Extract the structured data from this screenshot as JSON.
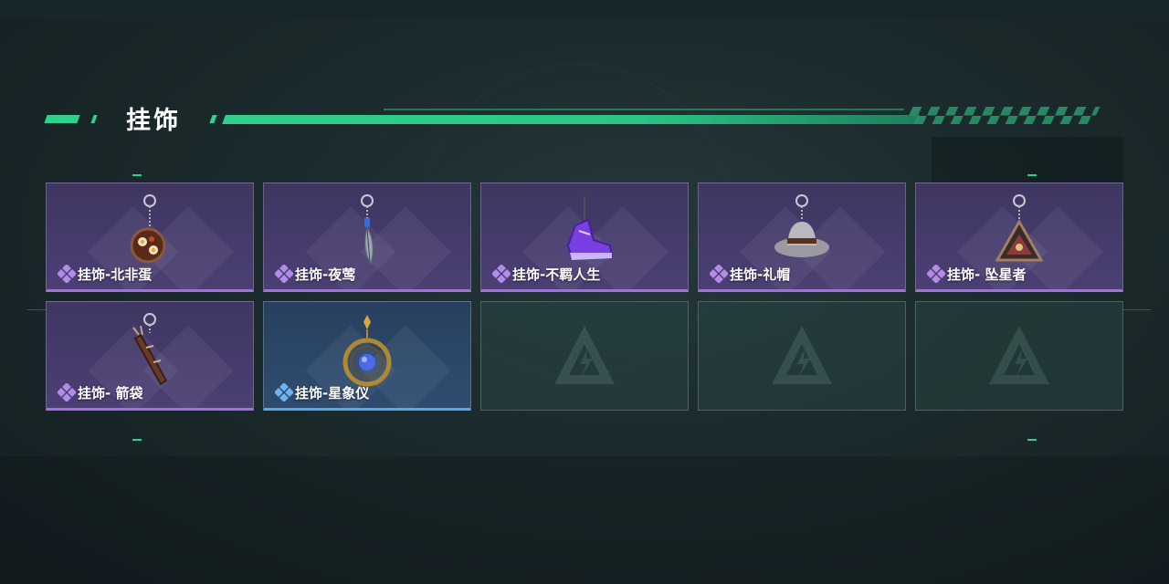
{
  "section": {
    "title": "挂饰"
  },
  "colors": {
    "accent": "#2fd08a",
    "purple_rarity": "#a46ee0",
    "blue_rarity": "#5aa6e6"
  },
  "items": [
    {
      "label": "挂饰-北非蛋",
      "rarity": "purple",
      "icon": "shakshuka-pan-charm-icon"
    },
    {
      "label": "挂饰-夜莺",
      "rarity": "purple",
      "icon": "feather-charm-icon"
    },
    {
      "label": "挂饰-不羁人生",
      "rarity": "purple",
      "icon": "sneaker-charm-icon"
    },
    {
      "label": "挂饰-礼帽",
      "rarity": "purple",
      "icon": "hat-charm-icon"
    },
    {
      "label": "挂饰- 坠星者",
      "rarity": "purple",
      "icon": "triangle-emblem-charm-icon"
    },
    {
      "label": "挂饰- 箭袋",
      "rarity": "purple",
      "icon": "quiver-charm-icon"
    },
    {
      "label": "挂饰-星象仪",
      "rarity": "blue",
      "icon": "astrolabe-charm-icon"
    }
  ],
  "empty_slots": 3
}
